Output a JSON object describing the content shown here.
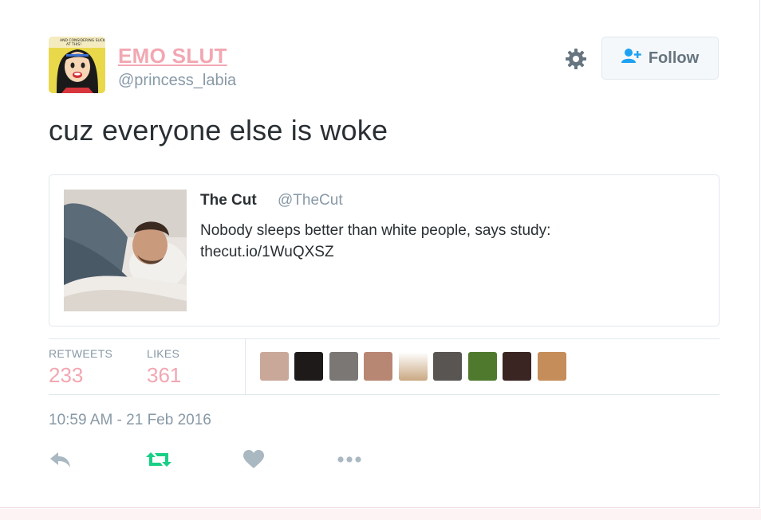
{
  "tweet": {
    "display_name": "EMO SLUT",
    "handle": "@princess_labia",
    "text": "cuz everyone else is woke",
    "timestamp": "10:59 AM - 21 Feb 2016",
    "avatar_icon": "comic-girl-avatar"
  },
  "header": {
    "follow_label": "Follow",
    "gear_icon": "gear-icon",
    "follow_icon": "add-user-icon"
  },
  "quoted_tweet": {
    "name": "The Cut",
    "handle": "@TheCut",
    "text_line1": "Nobody sleeps better than white people, says study:",
    "text_line2": "thecut.io/1WuQXSZ",
    "image_icon": "sleeping-man-photo"
  },
  "stats": {
    "retweets_label": "RETWEETS",
    "retweets_value": "233",
    "likes_label": "LIKES",
    "likes_value": "361",
    "liker_avatars_count": 9
  },
  "actions": {
    "reply_icon": "reply-icon",
    "retweet_icon": "retweet-icon",
    "like_icon": "heart-icon",
    "more_icon": "more-icon"
  },
  "colors": {
    "name_pink": "#f2a7b2",
    "muted": "#8899a6",
    "retweet_green": "#19cf86",
    "blue": "#1da1f2"
  }
}
